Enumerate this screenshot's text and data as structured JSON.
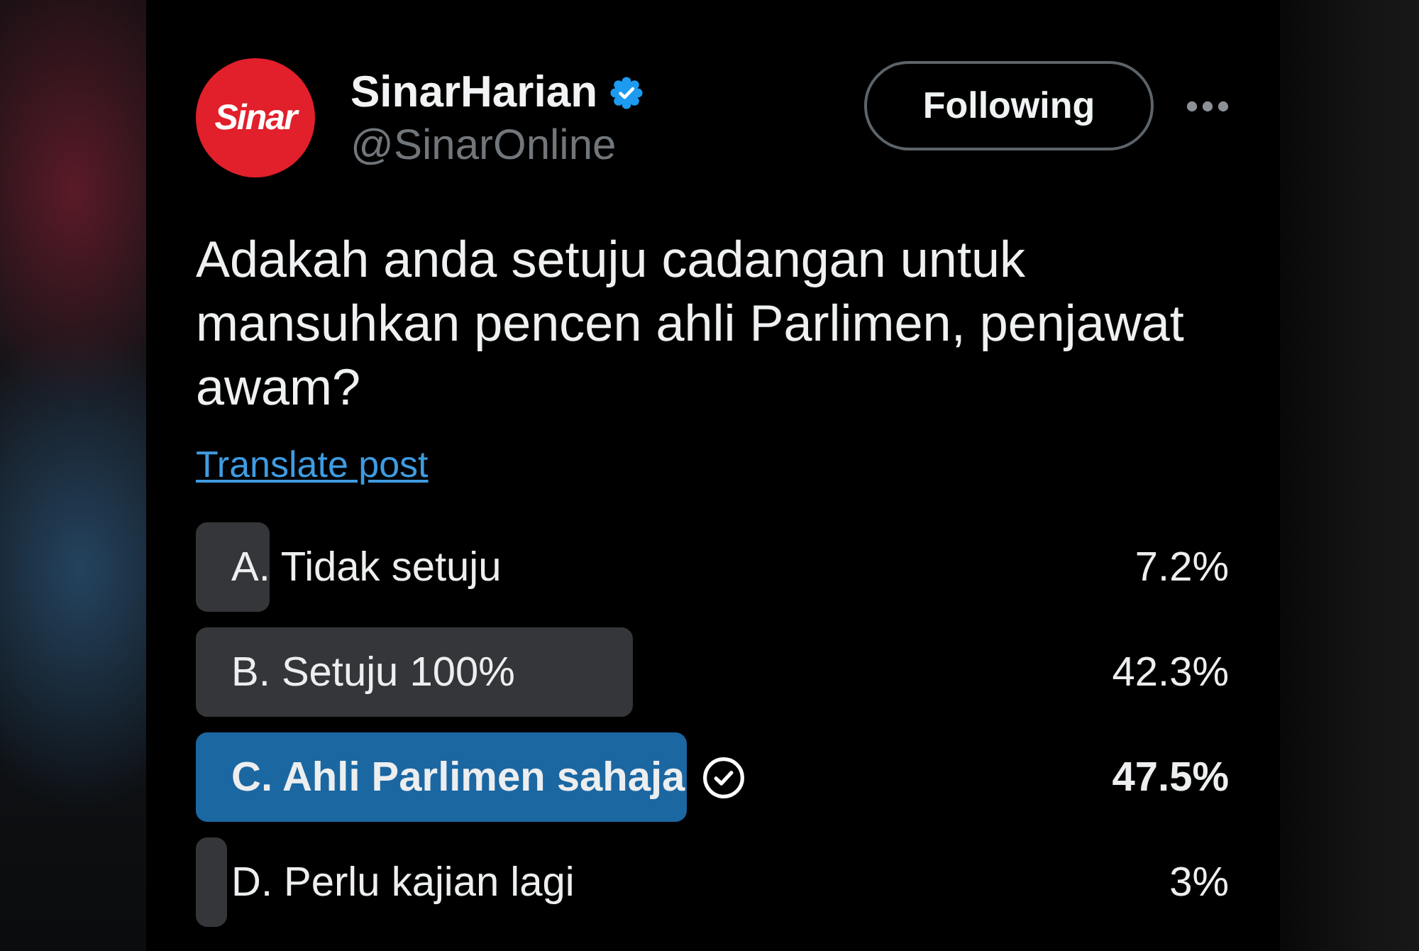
{
  "post": {
    "author": {
      "avatar_logo": "Sinar",
      "name": "SinarHarian",
      "verified": true,
      "handle": "@SinarOnline"
    },
    "follow_button": {
      "label": "Following"
    },
    "text": "Adakah anda setuju cadangan untuk mansuhkan pencen ahli Parlimen, penjawat awam?",
    "translate_link": "Translate post",
    "poll": {
      "options": [
        {
          "label": "A. Tidak setuju",
          "percent": "7.2%",
          "level": 0.072,
          "leading": false,
          "voted": false
        },
        {
          "label": "B. Setuju 100%",
          "percent": "42.3%",
          "level": 0.423,
          "leading": false,
          "voted": false
        },
        {
          "label": "C. Ahli Parlimen sahaja",
          "percent": "47.5%",
          "level": 0.475,
          "leading": true,
          "voted": true
        },
        {
          "label": "D. Perlu kajian lagi",
          "percent": "3%",
          "level": 0.03,
          "leading": false,
          "voted": false
        }
      ]
    }
  }
}
